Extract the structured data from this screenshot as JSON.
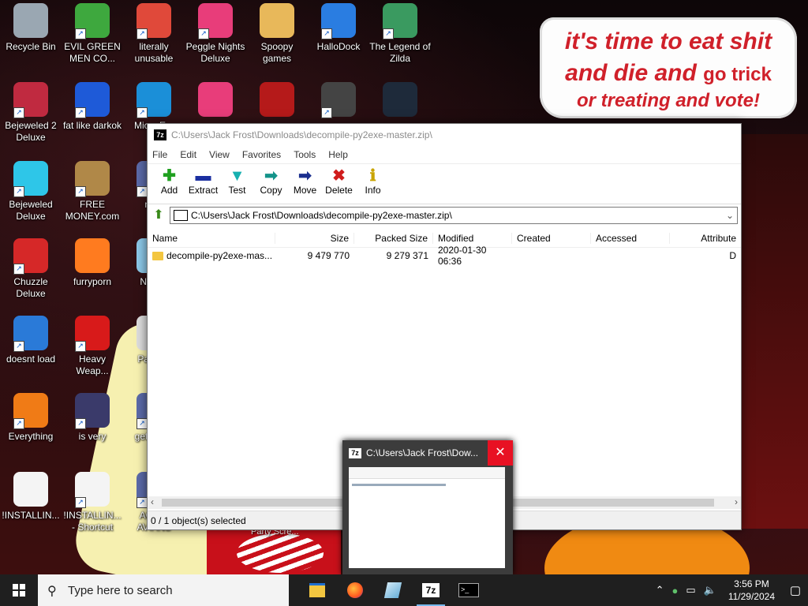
{
  "desktop": {
    "icons": [
      {
        "label": "Recycle Bin",
        "icon": "recycle-bin-icon",
        "shortcut": false
      },
      {
        "label": "EVIL GREEN MEN CO...",
        "icon": "green-men-icon",
        "shortcut": true
      },
      {
        "label": "literally unusable",
        "icon": "chrome-icon",
        "shortcut": true
      },
      {
        "label": "Peggle Nights Deluxe",
        "icon": "peggle-icon",
        "shortcut": true
      },
      {
        "label": "Spoopy games",
        "icon": "folder-icon",
        "shortcut": false
      },
      {
        "label": "HalloDock",
        "icon": "windows-shield-icon",
        "shortcut": true
      },
      {
        "label": "The Legend of Zilda",
        "icon": "game-character-icon",
        "shortcut": true
      },
      {
        "label": "Bejeweled 2 Deluxe",
        "icon": "bejeweled-2-icon",
        "shortcut": true
      },
      {
        "label": "fat like darkok",
        "icon": "mpl-icon",
        "shortcut": true
      },
      {
        "label": "Mic... E...",
        "icon": "edge-icon",
        "shortcut": true
      },
      {
        "label": "",
        "icon": "peggle-icon",
        "shortcut": false
      },
      {
        "label": "",
        "icon": "flash-icon",
        "shortcut": false
      },
      {
        "label": "",
        "icon": "network-icon",
        "shortcut": true
      },
      {
        "label": "",
        "icon": "yashma-icon",
        "shortcut": false
      },
      {
        "label": "Bejeweled Deluxe",
        "icon": "diamond-icon",
        "shortcut": true
      },
      {
        "label": "FREE MONEY.com",
        "icon": "money-bag-icon",
        "shortcut": true
      },
      {
        "label": "ne...",
        "icon": "app-icon",
        "shortcut": true
      },
      {
        "label": "Chuzzle Deluxe",
        "icon": "chuzzle-icon",
        "shortcut": true
      },
      {
        "label": "furryporn",
        "icon": "firefox-icon",
        "shortcut": false
      },
      {
        "label": "Note...",
        "icon": "notepad-icon",
        "shortcut": false
      },
      {
        "label": "doesnt load",
        "icon": "thunderbird-icon",
        "shortcut": true
      },
      {
        "label": "Heavy Weap...",
        "icon": "radiation-icon",
        "shortcut": true
      },
      {
        "label": "Paper...",
        "icon": "paper-icon",
        "shortcut": false
      },
      {
        "label": "Everything",
        "icon": "search-ring-icon",
        "shortcut": true
      },
      {
        "label": "is very",
        "icon": "mpl-shield-icon",
        "shortcut": true
      },
      {
        "label": "get... D...",
        "icon": "app-icon",
        "shortcut": true
      },
      {
        "label": "!INSTALLIN...",
        "icon": "document-icon",
        "shortcut": false
      },
      {
        "label": "!INSTALLIN... - Shortcut",
        "icon": "document-icon",
        "shortcut": true
      },
      {
        "label": "AGG... AVIANS",
        "icon": "app-icon",
        "shortcut": true
      }
    ],
    "wallpaper_text": {
      "line1": "it's time to eat shit",
      "line2_a": "and die and",
      "line2_b": "go trick",
      "line3": "or treating and vote!"
    },
    "wallpaper_fragment": "Party Scre..."
  },
  "window": {
    "title": "C:\\Users\\Jack Frost\\Downloads\\decompile-py2exe-master.zip\\",
    "app_icon": "7z",
    "menu": [
      "File",
      "Edit",
      "View",
      "Favorites",
      "Tools",
      "Help"
    ],
    "toolbar": [
      {
        "label": "Add",
        "glyph": "✚",
        "color": "#1fa01f"
      },
      {
        "label": "Extract",
        "glyph": "▬",
        "color": "#1b2fa0"
      },
      {
        "label": "Test",
        "glyph": "▼",
        "color": "#17b0b0"
      },
      {
        "label": "Copy",
        "glyph": "➡",
        "color": "#14948a"
      },
      {
        "label": "Move",
        "glyph": "➡",
        "color": "#1b2f8f"
      },
      {
        "label": "Delete",
        "glyph": "✖",
        "color": "#d01c1c"
      },
      {
        "label": "Info",
        "glyph": "ℹ",
        "color": "#c9a400"
      }
    ],
    "address": "C:\\Users\\Jack Frost\\Downloads\\decompile-py2exe-master.zip\\",
    "columns": [
      "Name",
      "Size",
      "Packed Size",
      "Modified",
      "Created",
      "Accessed",
      "Attribute"
    ],
    "rows": [
      {
        "name": "decompile-py2exe-mas...",
        "size": "9 479 770",
        "packed": "9 279 371",
        "modified": "2020-01-30 06:36",
        "created": "",
        "accessed": "",
        "attr": "D"
      }
    ],
    "status": "0 / 1 object(s) selected"
  },
  "preview": {
    "title": "C:\\Users\\Jack Frost\\Dow...",
    "app_icon": "7z",
    "close": "✕"
  },
  "taskbar": {
    "search_placeholder": "Type here to search",
    "items": [
      {
        "name": "file-explorer-icon",
        "active": false
      },
      {
        "name": "firefox-icon",
        "active": false
      },
      {
        "name": "app-icon",
        "active": false
      },
      {
        "name": "7zip-icon",
        "label": "7z",
        "active": true
      },
      {
        "name": "terminal-icon",
        "active": false
      }
    ],
    "time": "3:56 PM",
    "date": "11/29/2024"
  }
}
